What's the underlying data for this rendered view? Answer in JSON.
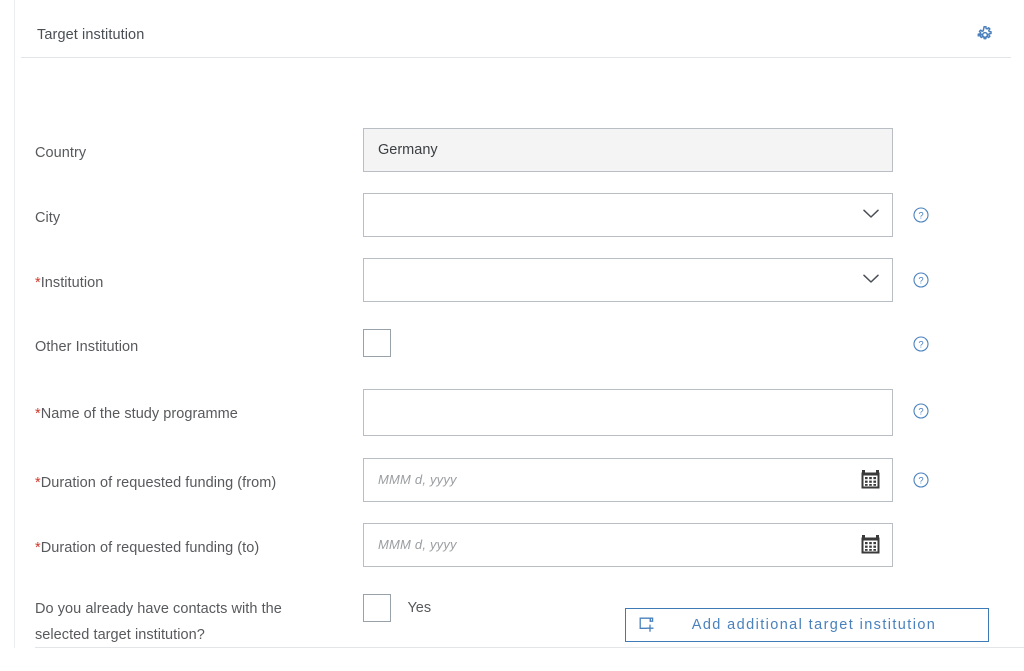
{
  "header": {
    "title": "Target institution",
    "settings_icon": "gear-icon"
  },
  "form": {
    "rows": [
      {
        "id": "country",
        "label": "Country",
        "required": false,
        "type": "readonly-text",
        "value": "Germany",
        "placeholder": "",
        "help": false
      },
      {
        "id": "city",
        "label": "City",
        "required": false,
        "type": "select",
        "value": "",
        "placeholder": "",
        "help": true
      },
      {
        "id": "institution",
        "label": "Institution",
        "required": true,
        "type": "select",
        "value": "",
        "placeholder": "",
        "help": true
      },
      {
        "id": "other-institution",
        "label": "Other Institution",
        "required": false,
        "type": "checkbox",
        "checked": false,
        "checkbox_label": "",
        "help": true
      },
      {
        "id": "study-programme",
        "label": "Name of the study programme",
        "required": true,
        "type": "text",
        "value": "",
        "placeholder": "",
        "help": true
      },
      {
        "id": "funding-from",
        "label": "Duration of requested funding (from)",
        "required": true,
        "type": "date",
        "value": "",
        "placeholder": "MMM d, yyyy",
        "help": true
      },
      {
        "id": "funding-to",
        "label": "Duration of requested funding (to)",
        "required": true,
        "type": "date",
        "value": "",
        "placeholder": "MMM d, yyyy",
        "help": false
      },
      {
        "id": "existing-contacts",
        "label": "Do you already have contacts with the selected target institution?",
        "required": false,
        "type": "checkbox",
        "checked": false,
        "checkbox_label": "Yes",
        "help": false
      }
    ],
    "required_marker": "*"
  },
  "actions": {
    "add_institution_label": "Add additional target institution",
    "add_institution_icon": "add-page-icon"
  },
  "colors": {
    "accent_blue": "#4a81bd",
    "required_red": "#d0392b",
    "label_gray": "#57595c",
    "border_gray": "#b8bec4",
    "readonly_bg": "#f4f4f4",
    "divider": "#e3e6e8"
  }
}
